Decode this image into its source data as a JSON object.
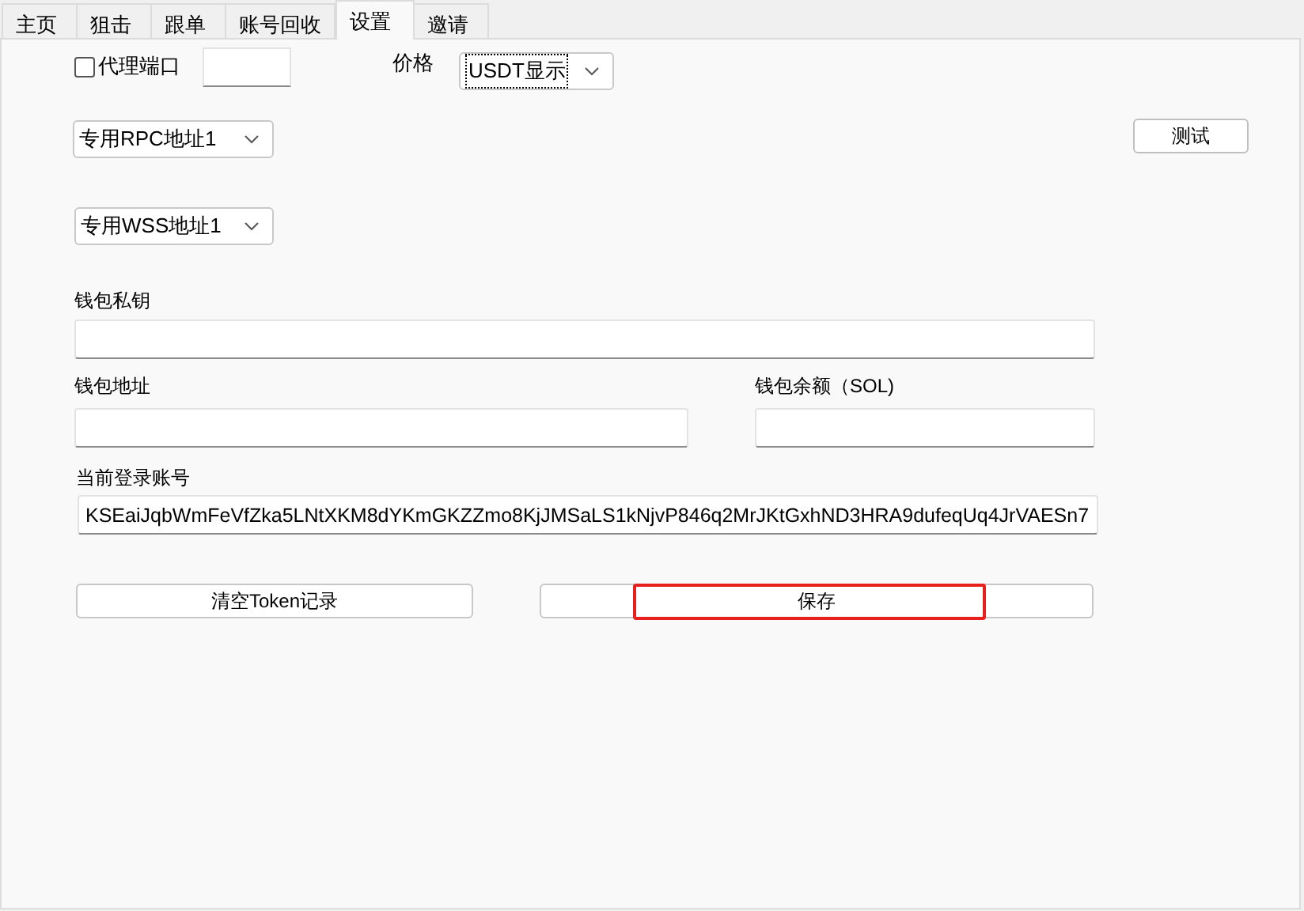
{
  "tabs": [
    {
      "label": "主页",
      "selected": false
    },
    {
      "label": "狙击",
      "selected": false
    },
    {
      "label": "跟单",
      "selected": false
    },
    {
      "label": "账号回收",
      "selected": false
    },
    {
      "label": "设置",
      "selected": true
    },
    {
      "label": "邀请",
      "selected": false
    }
  ],
  "proxy": {
    "label": "代理端口",
    "checked": false
  },
  "price": {
    "label": "价格",
    "value": "USDT显示"
  },
  "rpc_select": {
    "value": "专用RPC地址1"
  },
  "test_button": "测试",
  "wss_select": {
    "value": "专用WSS地址1"
  },
  "private_key": {
    "label": "钱包私钥"
  },
  "wallet_address": {
    "label": "钱包地址"
  },
  "wallet_balance": {
    "label": "钱包余额（SOL)"
  },
  "current_account": {
    "label": "当前登录账号",
    "value": "KSEaiJqbWmFeVfZka5LNtXKM8dYKmGKZZmo8KjJMSaLS1kNjvP846q2MrJKtGxhND3HRA9dufeqUq4JrVAESn7"
  },
  "clear_button": "清空Token记录",
  "save_button": {
    "label": "保存",
    "highlighted": true
  }
}
